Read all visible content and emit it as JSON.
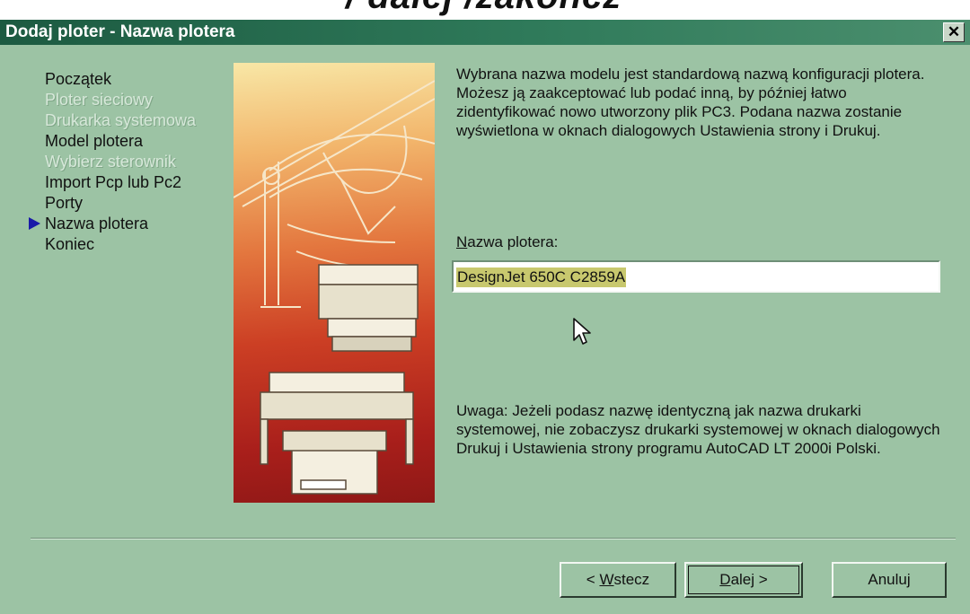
{
  "banner": {
    "text": "/ dalej  /zakończ"
  },
  "window": {
    "title": "Dodaj ploter - Nazwa plotera",
    "close_glyph": "✕"
  },
  "steps": [
    {
      "label": "Początek",
      "state": "enabled"
    },
    {
      "label": "Ploter sieciowy",
      "state": "disabled"
    },
    {
      "label": "Drukarka systemowa",
      "state": "disabled"
    },
    {
      "label": "Model plotera",
      "state": "enabled"
    },
    {
      "label": "Wybierz sterownik",
      "state": "disabled"
    },
    {
      "label": "Import Pcp lub Pc2",
      "state": "enabled"
    },
    {
      "label": "Porty",
      "state": "enabled"
    },
    {
      "label": "Nazwa plotera",
      "state": "current"
    },
    {
      "label": "Koniec",
      "state": "enabled"
    }
  ],
  "content": {
    "description": "Wybrana nazwa modelu jest standardową nazwą konfiguracji plotera. Możesz ją zaakceptować lub podać inną, by później łatwo zidentyfikować nowo utworzony plik PC3. Podana nazwa zostanie wyświetlona w oknach dialogowych Ustawienia strony i Drukuj.",
    "field_label_hotkey": "N",
    "field_label_rest": "azwa plotera:",
    "field_value": "DesignJet 650C C2859A",
    "note": "Uwaga: Jeżeli podasz nazwę identyczną jak nazwa drukarki systemowej, nie zobaczysz drukarki systemowej w oknach dialogowych Drukuj i Ustawienia strony programu AutoCAD LT 2000i Polski."
  },
  "buttons": {
    "back_prefix": "< ",
    "back_hotkey": "W",
    "back_rest": "stecz",
    "next_hotkey": "D",
    "next_rest": "alej >",
    "cancel": "Anuluj"
  },
  "icons": {
    "close": "close-icon",
    "current_step": "arrow-right-icon",
    "pointer": "mouse-pointer-icon"
  },
  "colors": {
    "dialog_bg": "#9cc3a4",
    "titlebar": "#1c5a41",
    "current_step_arrow": "#1a1aa8",
    "selection": "#c8c86e"
  }
}
